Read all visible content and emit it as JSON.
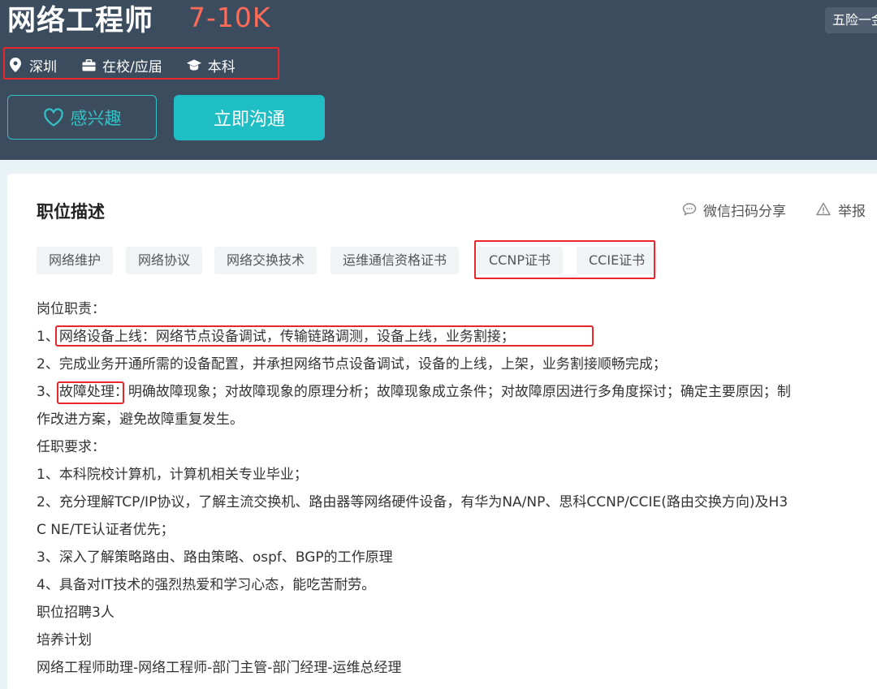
{
  "header": {
    "job_title": "网络工程师",
    "salary": "7-10K",
    "benefit_tag": "五险一金",
    "meta": {
      "city": "深圳",
      "experience": "在校/应届",
      "degree": "本科"
    },
    "interest_label": "感兴趣",
    "chat_label": "立即沟通"
  },
  "section": {
    "title": "职位描述",
    "share_label": "微信扫码分享",
    "report_label": "举报"
  },
  "tags": [
    "网络维护",
    "网络协议",
    "网络交换技术",
    "运维通信资格证书",
    "CCNP证书",
    "CCIE证书"
  ],
  "description": [
    "岗位职责：",
    "1、网络设备上线：网络节点设备调试，传输链路调测，设备上线，业务割接；",
    "2、完成业务开通所需的设备配置，并承担网络节点设备调试，设备的上线，上架，业务割接顺畅完成；",
    "3、故障处理：明确故障现象；对故障现象的原理分析；故障现象成立条件；对故障原因进行多角度探讨；确定主要原因；制",
    "作改进方案，避免故障重复发生。",
    "任职要求：",
    "1、本科院校计算机，计算机相关专业毕业；",
    "2、充分理解TCP/IP协议，了解主流交换机、路由器等网络硬件设备，有华为NA/NP、思科CCNP/CCIE(路由交换方向)及H3",
    "C NE/TE认证者优先；",
    "3、深入了解策略路由、路由策略、ospf、BGP的工作原理",
    "4、具备对IT技术的强烈热爱和学习心态，能吃苦耐劳。",
    "职位招聘3人",
    "培养计划",
    "网络工程师助理-网络工程师-部门主管-部门经理-运维总经理"
  ],
  "colors": {
    "header_bg": "#3c4c5f",
    "salary": "#ff6b57",
    "accent": "#1fbec4",
    "highlight_box": "#e8262b"
  },
  "icons": {
    "city": "location-pin-icon",
    "experience": "briefcase-icon",
    "degree": "graduation-cap-icon",
    "interest": "heart-outline-icon",
    "share": "chat-bubble-icon",
    "report": "warning-triangle-icon"
  }
}
